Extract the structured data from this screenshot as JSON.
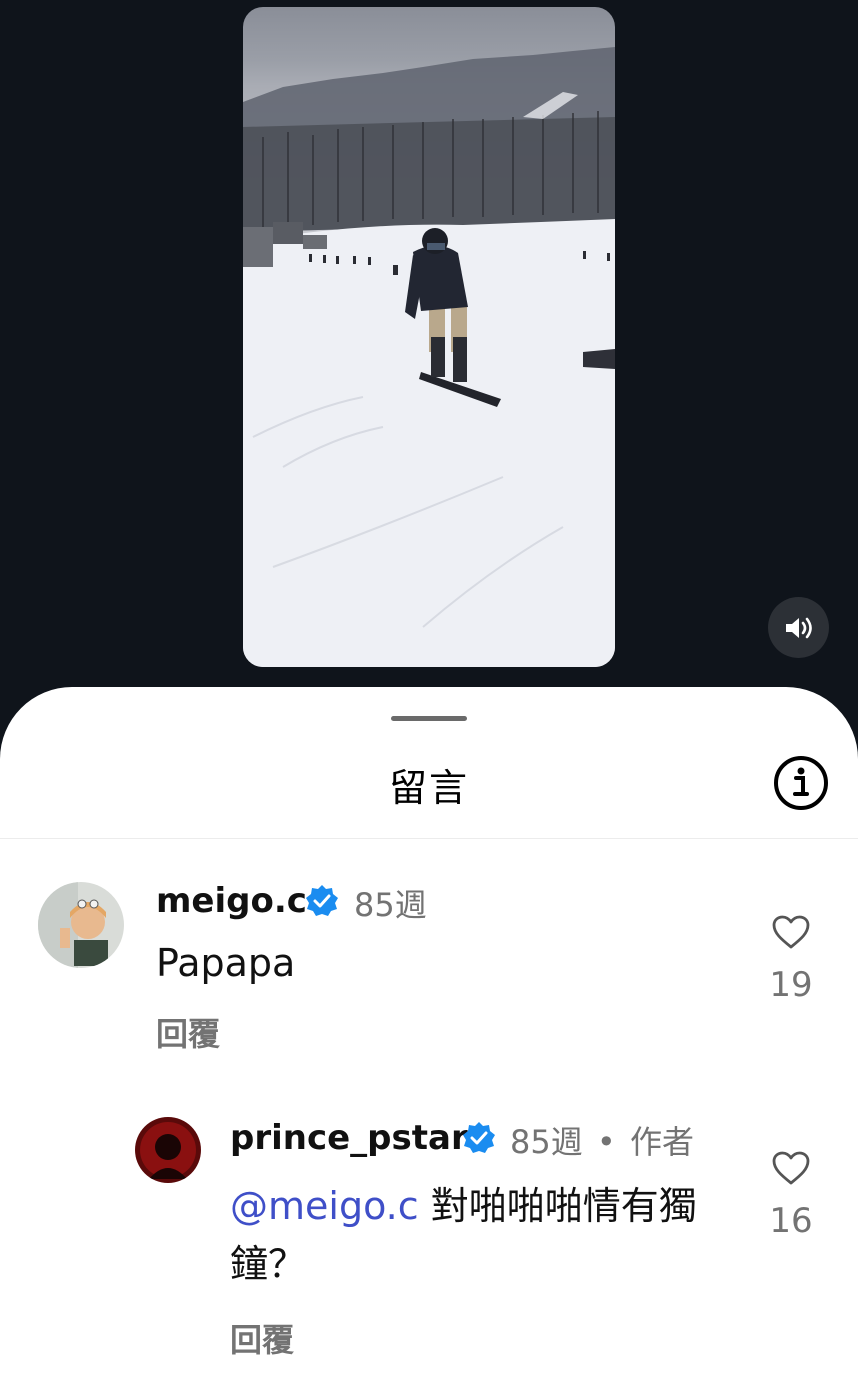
{
  "video": {
    "mute_icon": "speaker-icon"
  },
  "sheet": {
    "title": "留言",
    "info_icon": "info-icon"
  },
  "comments": [
    {
      "username": "meigo.c",
      "verified": true,
      "time": "85週",
      "text": "Papapa",
      "reply_label": "回覆",
      "likes": "19"
    },
    {
      "username": "prince_pstar",
      "verified": true,
      "time": "85週",
      "separator": "•",
      "author_tag": "作者",
      "mention": "@meigo.c",
      "text": " 對啪啪啪情有獨鐘？",
      "reply_label": "回覆",
      "likes": "16"
    }
  ],
  "colors": {
    "verified": "#1a8cf0",
    "mention": "#3f4fc8",
    "muted_text": "#737373",
    "backdrop": "#0f141b"
  }
}
